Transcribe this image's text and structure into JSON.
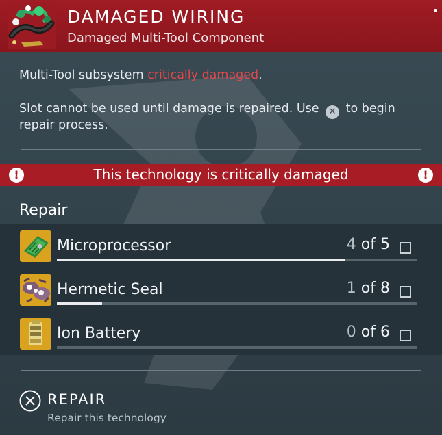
{
  "header": {
    "title": "DAMAGED WIRING",
    "subtitle": "Damaged Multi-Tool Component",
    "icon": "damaged-wiring-icon"
  },
  "description": {
    "line1_prefix": "Multi-Tool subsystem ",
    "line1_highlight": "critically damaged",
    "line1_suffix": ".",
    "line2_prefix": "Slot cannot be used until damage is repaired. Use ",
    "line2_button_glyph": "✕",
    "line2_suffix": " to begin",
    "line3": "repair process."
  },
  "warning": {
    "text": "This technology is critically damaged",
    "icon_glyph": "!"
  },
  "repair": {
    "title": "Repair",
    "items": [
      {
        "name": "Microprocessor",
        "have": "4",
        "of": " of ",
        "need": "5",
        "progress": 0.8,
        "icon": "microprocessor-icon"
      },
      {
        "name": "Hermetic Seal",
        "have": "1",
        "of": " of ",
        "need": "8",
        "progress": 0.125,
        "icon": "hermetic-seal-icon"
      },
      {
        "name": "Ion Battery",
        "have": "0",
        "of": " of ",
        "need": "6",
        "progress": 0.0,
        "icon": "ion-battery-icon"
      }
    ]
  },
  "action": {
    "label": "REPAIR",
    "sublabel": "Repair this technology",
    "button_glyph": "✕"
  },
  "colors": {
    "header_red": "#a01c24",
    "critical_text": "#e0494b",
    "warning_bar": "#a81d25"
  }
}
